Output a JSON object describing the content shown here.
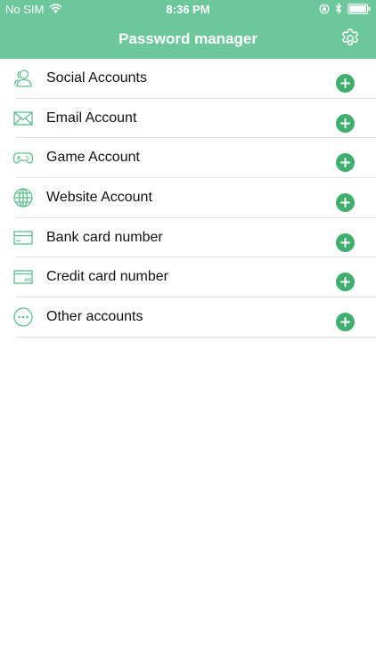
{
  "status_bar": {
    "carrier": "No SIM",
    "time": "8:36 PM",
    "icons": [
      "wifi-icon",
      "orientation-lock-icon",
      "bluetooth-icon",
      "battery-icon"
    ]
  },
  "nav": {
    "title": "Password manager",
    "settings_icon": "gear-icon"
  },
  "categories": [
    {
      "label": "Social Accounts",
      "icon": "people-icon"
    },
    {
      "label": "Email Account",
      "icon": "envelope-icon"
    },
    {
      "label": "Game Account",
      "icon": "gamepad-icon"
    },
    {
      "label": "Website Account",
      "icon": "globe-icon"
    },
    {
      "label": "Bank card number",
      "icon": "bank-card-icon"
    },
    {
      "label": "Credit card number",
      "icon": "credit-card-icon"
    },
    {
      "label": "Other accounts",
      "icon": "more-dots-icon"
    }
  ],
  "colors": {
    "header": "#6cc89a",
    "add_button": "#3fae6e",
    "icon_stroke": "#5cbf8d"
  }
}
